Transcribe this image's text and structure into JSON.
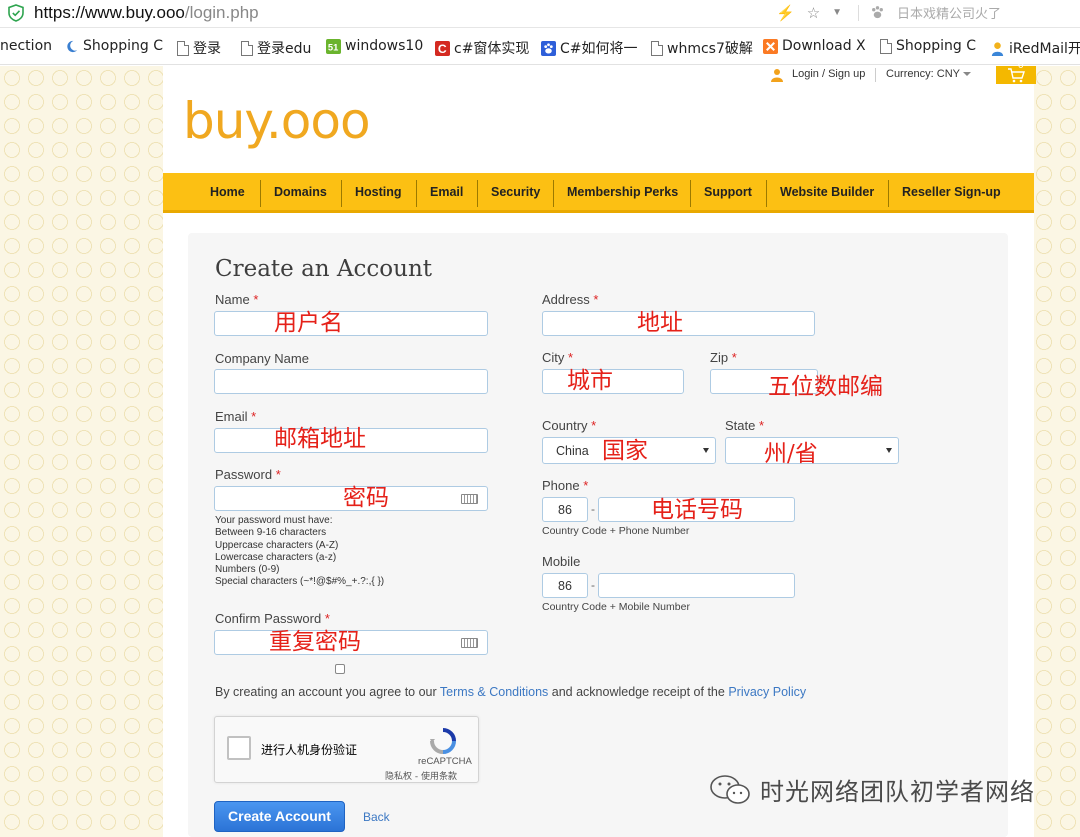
{
  "browser": {
    "url_scheme_host": "https://www.buy.ooo",
    "url_path": "/login.php",
    "search_hint": "日本戏精公司火了"
  },
  "bookmarks": [
    {
      "label": "nection",
      "icon": "none"
    },
    {
      "label": "Shopping C",
      "icon": "crescent-icon"
    },
    {
      "label": "登录",
      "icon": "page-icon"
    },
    {
      "label": "登录edu",
      "icon": "page-icon"
    },
    {
      "label": "windows10",
      "icon": "fifty-one-cto-icon"
    },
    {
      "label": "c#窗体实现",
      "icon": "csdn-icon"
    },
    {
      "label": "C#如何将一",
      "icon": "baidu-paw-icon"
    },
    {
      "label": "whmcs7破解",
      "icon": "page-icon"
    },
    {
      "label": "Download X",
      "icon": "xampp-icon"
    },
    {
      "label": "Shopping C",
      "icon": "page-icon"
    },
    {
      "label": "iRedMail开",
      "icon": "person-icon"
    }
  ],
  "header": {
    "login_label": "Login / Sign up",
    "currency_label": "Currency:",
    "currency_value": "CNY",
    "cart_count": "0",
    "logo_text": "buy.ooo"
  },
  "nav": {
    "items": [
      "Home",
      "Domains",
      "Hosting",
      "Email",
      "Security",
      "Membership Perks",
      "Support",
      "Website Builder",
      "Reseller Sign-up"
    ]
  },
  "form": {
    "title": "Create an Account",
    "name_label": "Name",
    "company_label": "Company Name",
    "email_label": "Email",
    "password_label": "Password",
    "confirm_password_label": "Confirm Password",
    "address_label": "Address",
    "city_label": "City",
    "zip_label": "Zip",
    "country_label": "Country",
    "state_label": "State",
    "phone_label": "Phone",
    "mobile_label": "Mobile",
    "required_mark": "*",
    "country_value": "China",
    "phone_code": "86",
    "mobile_code": "86",
    "code_dash": "-",
    "phone_hint": "Country Code + Phone Number",
    "mobile_hint": "Country Code + Mobile Number",
    "password_rules_title": "Your password must have:",
    "password_rules": [
      "Between 9-16 characters",
      "Uppercase characters (A-Z)",
      "Lowercase characters (a-z)",
      "Numbers (0-9)",
      "Special characters (~*!@$#%_+.?:,{ })"
    ],
    "terms_prefix": "By creating an account you agree to our",
    "terms_link": "Terms & Conditions",
    "terms_middle": "and acknowledge receipt of the",
    "privacy_link": "Privacy Policy",
    "create_button": "Create Account",
    "back_link": "Back"
  },
  "annotations": {
    "name": "用户名",
    "email": "邮箱地址",
    "password": "密码",
    "confirm_password": "重复密码",
    "address": "地址",
    "city": "城市",
    "zip": "五位数邮编",
    "country": "国家",
    "state": "州/省",
    "phone": "电话号码",
    "color": "#e52119"
  },
  "recaptcha": {
    "label": "进行人机身份验证",
    "brand": "reCAPTCHA",
    "links": "隐私权 - 使用条款"
  },
  "watermark": {
    "text": "时光网络团队初学者网络"
  },
  "colors": {
    "nav_bg": "#fcc013",
    "logo": "#f0a820",
    "link": "#3c78c3",
    "button": "#2b73d6"
  }
}
